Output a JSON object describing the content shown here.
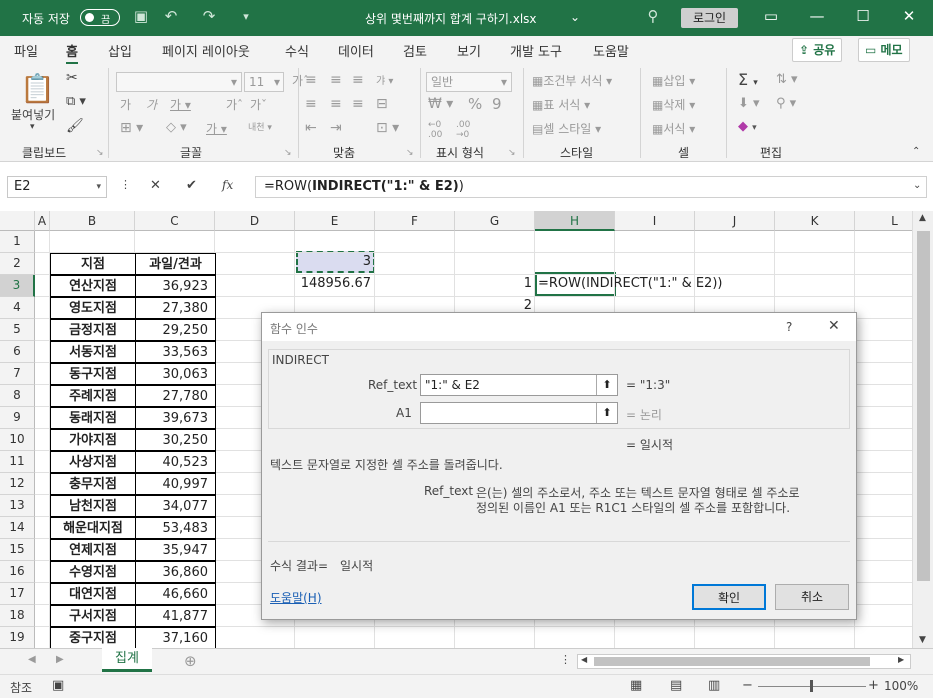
{
  "titlebar": {
    "autosave": "자동 저장",
    "toggle": "끔",
    "filename": "상위 몇번째까지 합계 구하기.xlsx",
    "dropdown": "⌄",
    "login": "로그인"
  },
  "menu": {
    "tabs": [
      "파일",
      "홈",
      "삽입",
      "페이지 레이아웃",
      "수식",
      "데이터",
      "검토",
      "보기",
      "개발 도구",
      "도움말"
    ],
    "share": "공유",
    "memo": "메모"
  },
  "ribbon": {
    "groups": [
      "클립보드",
      "글꼴",
      "맞춤",
      "표시 형식",
      "스타일",
      "셀",
      "편집"
    ],
    "paste": "붙여넣기",
    "font_size": "11",
    "number_format": "일반",
    "style_items": [
      "조건부 서식",
      "표 서식",
      "셀 스타일"
    ],
    "cell_items": [
      "삽입",
      "삭제",
      "서식"
    ]
  },
  "formula_bar": {
    "name_box": "E2",
    "fx": "fx",
    "formula_prefix": "=ROW(",
    "formula_bold": "INDIRECT(\"1:\" & E2)",
    "formula_suffix": ")"
  },
  "columns": [
    "A",
    "B",
    "C",
    "D",
    "E",
    "F",
    "G",
    "H",
    "I",
    "J",
    "K",
    "L"
  ],
  "rows": [
    "1",
    "2",
    "3",
    "4",
    "5",
    "6",
    "7",
    "8",
    "9",
    "10",
    "11",
    "12",
    "13",
    "14",
    "15",
    "16",
    "17",
    "18",
    "19"
  ],
  "table": {
    "header": [
      "지점",
      "과일/견과"
    ],
    "rows": [
      [
        "연산지점",
        "36,923"
      ],
      [
        "영도지점",
        "27,380"
      ],
      [
        "금정지점",
        "29,250"
      ],
      [
        "서동지점",
        "33,563"
      ],
      [
        "동구지점",
        "30,063"
      ],
      [
        "주례지점",
        "27,780"
      ],
      [
        "동래지점",
        "39,673"
      ],
      [
        "가야지점",
        "30,250"
      ],
      [
        "사상지점",
        "40,523"
      ],
      [
        "충무지점",
        "40,997"
      ],
      [
        "남천지점",
        "34,077"
      ],
      [
        "해운대지점",
        "53,483"
      ],
      [
        "연제지점",
        "35,947"
      ],
      [
        "수영지점",
        "36,860"
      ],
      [
        "대연지점",
        "46,660"
      ],
      [
        "구서지점",
        "41,877"
      ],
      [
        "중구지점",
        "37,160"
      ]
    ]
  },
  "cells": {
    "E2": "3",
    "E3": "148956.67",
    "G3": "1",
    "H3": "=ROW(INDIRECT(\"1:\" & E2))",
    "G4": "2"
  },
  "sheet_tab": "집계",
  "status": {
    "ready": "참조",
    "zoom": "100%"
  },
  "dialog": {
    "title": "함수 인수",
    "help_q": "?",
    "function_name": "INDIRECT",
    "arg1_label": "Ref_text",
    "arg1_value": "\"1:\" & E2",
    "arg1_result": "=  \"1:3\"",
    "arg2_label": "A1",
    "arg2_value": "",
    "arg2_result": "=  논리",
    "overall_result": "=  일시적",
    "description": "텍스트 문자열로 지정한 셀 주소를 돌려줍니다.",
    "arg_desc_label": "Ref_text",
    "arg_desc_line1": "은(는) 셀의 주소로서, 주소 또는 텍스트 문자열 형태로 셀 주소로",
    "arg_desc_line2": "정의된 이름인 A1 또는 R1C1 스타일의 셀 주소를 포함합니다.",
    "formula_result_label": "수식 결과=",
    "formula_result_value": "일시적",
    "help_link": "도움말(H)",
    "ok": "확인",
    "cancel": "취소"
  }
}
